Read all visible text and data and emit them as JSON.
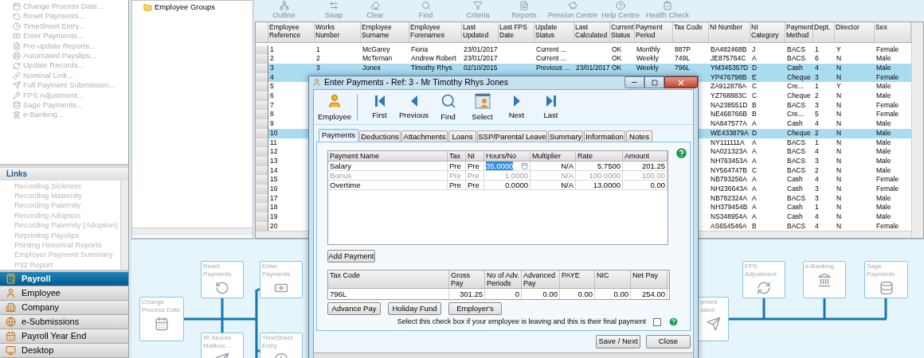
{
  "tasks": [
    {
      "label": "Change Process Date...",
      "disabled": true
    },
    {
      "label": "Reset Payments...",
      "disabled": true
    },
    {
      "label": "TimeSheet Entry...",
      "disabled": true
    },
    {
      "label": "Enter Payments...",
      "disabled": true
    },
    {
      "label": "Pre-update Reports...",
      "disabled": true
    },
    {
      "label": "Automated Payslips...",
      "disabled": true
    },
    {
      "label": "Update Records...",
      "disabled": true
    },
    {
      "label": "Nominal Link...",
      "disabled": true
    },
    {
      "label": "Full Payment Submission...",
      "disabled": true
    },
    {
      "label": "FPS Adjustment...",
      "disabled": true
    },
    {
      "label": "Sage Payments...",
      "disabled": true
    },
    {
      "label": "e-Banking...",
      "disabled": true
    }
  ],
  "links": {
    "title": "Links",
    "items": [
      {
        "label": "Recording Sickness",
        "disabled": true
      },
      {
        "label": "Recording Maternity",
        "disabled": true
      },
      {
        "label": "Recording Paternity",
        "disabled": true
      },
      {
        "label": "Recording Adoption",
        "disabled": true
      },
      {
        "label": "Recording Paternity (Adoption)",
        "disabled": true
      },
      {
        "label": "Reprinting Payslips",
        "disabled": true
      },
      {
        "label": "Printing Historical Reports",
        "disabled": true
      },
      {
        "label": "Employer Payment Summary",
        "disabled": true
      },
      {
        "label": "P32 Report",
        "disabled": true
      }
    ]
  },
  "nav": [
    {
      "label": "Payroll",
      "selected": true
    },
    {
      "label": "Employee",
      "selected": false
    },
    {
      "label": "Company",
      "selected": false
    },
    {
      "label": "e-Submissions",
      "selected": false
    },
    {
      "label": "Payroll Year End",
      "selected": false
    },
    {
      "label": "Desktop",
      "selected": false
    }
  ],
  "tree": {
    "items": [
      {
        "label": "Employee Groups"
      }
    ]
  },
  "toolbar": [
    {
      "label": "Outline",
      "disabled": true
    },
    {
      "label": "Swap",
      "disabled": true
    },
    {
      "label": "Clear",
      "disabled": true
    },
    {
      "label": "Find",
      "disabled": true
    },
    {
      "label": "Criteria",
      "disabled": true
    },
    {
      "label": "Reports",
      "disabled": true
    },
    {
      "label": "Pension Centre",
      "disabled": true
    },
    {
      "label": "Help Centre",
      "disabled": true
    },
    {
      "label": "Health Check",
      "disabled": true
    }
  ],
  "table": {
    "columns": [
      "Employee Reference",
      "Works Number",
      "Employee Surname",
      "Employee Forenames",
      "Last Updated",
      "Last FPS Date",
      "Update Status",
      "Last Calculated",
      "Current Status",
      "Payment Period",
      "Tax Code",
      "NI Number",
      "NI Category",
      "Payment Method",
      "Dept.",
      "Director",
      "Sex"
    ],
    "rows": [
      {
        "selected": false,
        "cells": [
          "1",
          "1",
          "McGarey",
          "Fiona",
          "23/01/2017",
          null,
          "Current ...",
          null,
          "OK",
          "Monthly",
          "887P",
          "BA482468B",
          "J",
          "BACS",
          "1",
          "Y",
          "Female"
        ]
      },
      {
        "selected": false,
        "cells": [
          "2",
          "2",
          "McTernan",
          "Andrew Robert",
          "23/01/2017",
          null,
          "Current ...",
          null,
          "OK",
          "Weekly",
          "749L",
          "JE875764C",
          "A",
          "BACS",
          "6",
          "N",
          "Male"
        ]
      },
      {
        "selected": true,
        "cells": [
          "3",
          "3",
          "Jones",
          "Timothy Rhys",
          "02/10/2015",
          null,
          "Previous ...",
          "23/01/2017",
          "OK",
          "Weekly",
          "796L",
          "YM345357D",
          "D",
          "Cash",
          "4",
          "N",
          "Male"
        ]
      },
      {
        "selected": true,
        "cells": [
          "4",
          null,
          null,
          null,
          null,
          null,
          null,
          null,
          null,
          null,
          null,
          "YP476798B",
          "E",
          "Cheque",
          "3",
          "N",
          "Female"
        ]
      },
      {
        "selected": false,
        "cells": [
          "5",
          null,
          null,
          null,
          null,
          null,
          null,
          null,
          null,
          null,
          null,
          "ZA912878A",
          "C",
          "Cre...",
          "1",
          "Y",
          "Male"
        ]
      },
      {
        "selected": false,
        "cells": [
          "6",
          null,
          null,
          null,
          null,
          null,
          null,
          null,
          null,
          null,
          null,
          "YZ768883C",
          "C",
          "Cheque",
          "2",
          "N",
          "Male"
        ]
      },
      {
        "selected": false,
        "cells": [
          "7",
          null,
          null,
          null,
          null,
          null,
          null,
          null,
          null,
          null,
          null,
          "NA238551D",
          "B",
          "BACS",
          "3",
          "N",
          "Female"
        ]
      },
      {
        "selected": false,
        "cells": [
          "8",
          null,
          null,
          null,
          null,
          null,
          null,
          null,
          null,
          null,
          null,
          "NE468766B",
          "B",
          "Cre...",
          "5",
          "N",
          "Female"
        ]
      },
      {
        "selected": false,
        "cells": [
          "9",
          null,
          null,
          null,
          null,
          null,
          null,
          null,
          null,
          null,
          null,
          "NA847577A",
          "A",
          "Cash",
          "4",
          "N",
          "Male"
        ]
      },
      {
        "selected": true,
        "cells": [
          "10",
          null,
          null,
          null,
          null,
          null,
          null,
          null,
          null,
          null,
          null,
          "WE433879A",
          "D",
          "Cheque",
          "2",
          "N",
          "Male"
        ]
      },
      {
        "selected": false,
        "cells": [
          "11",
          null,
          null,
          null,
          null,
          null,
          null,
          null,
          null,
          null,
          null,
          "NY111111A",
          "A",
          "BACS",
          "1",
          "N",
          "Male"
        ]
      },
      {
        "selected": false,
        "cells": [
          "12",
          null,
          null,
          null,
          null,
          null,
          null,
          null,
          null,
          null,
          null,
          "NA021323A",
          "A",
          "BACS",
          "4",
          "N",
          "Male"
        ]
      },
      {
        "selected": false,
        "cells": [
          "13",
          null,
          null,
          null,
          null,
          null,
          null,
          null,
          null,
          null,
          null,
          "NH763453A",
          "A",
          "BACS",
          "3",
          "N",
          "Male"
        ]
      },
      {
        "selected": false,
        "cells": [
          "14",
          null,
          null,
          null,
          null,
          null,
          null,
          null,
          null,
          null,
          null,
          "NY564747B",
          "C",
          "BACS",
          "2",
          "N",
          "Male"
        ]
      },
      {
        "selected": false,
        "cells": [
          "15",
          null,
          null,
          null,
          null,
          null,
          null,
          null,
          null,
          null,
          null,
          "NB793256A",
          "A",
          "Cash",
          "4",
          "N",
          "Female"
        ]
      },
      {
        "selected": false,
        "cells": [
          "16",
          null,
          null,
          null,
          null,
          null,
          null,
          null,
          null,
          null,
          null,
          "NH236643A",
          "A",
          "Cash",
          "3",
          "N",
          "Female"
        ]
      },
      {
        "selected": false,
        "cells": [
          "17",
          null,
          null,
          null,
          null,
          null,
          null,
          null,
          null,
          null,
          null,
          "NB782324A",
          "A",
          "BACS",
          "3",
          "N",
          "Male"
        ]
      },
      {
        "selected": false,
        "cells": [
          "18",
          null,
          null,
          null,
          null,
          null,
          null,
          null,
          null,
          null,
          null,
          "NH379454B",
          "A",
          "Cash",
          "1",
          "N",
          "Male"
        ]
      },
      {
        "selected": false,
        "cells": [
          "19",
          null,
          null,
          null,
          null,
          null,
          null,
          null,
          null,
          null,
          null,
          "NS348954A",
          "A",
          "Cash",
          "4",
          "N",
          "Male"
        ]
      },
      {
        "selected": false,
        "cells": [
          "20",
          null,
          null,
          null,
          null,
          null,
          null,
          null,
          null,
          null,
          null,
          "AS654546A",
          "B",
          "BACS",
          "4",
          "N",
          "Female"
        ]
      }
    ]
  },
  "flow": {
    "nodes": [
      {
        "lines": [
          "Change",
          "Process Date"
        ]
      },
      {
        "lines": [
          "Reset",
          "Payments"
        ]
      },
      {
        "lines": [
          "IR Secure",
          "Mailbox..."
        ]
      },
      {
        "lines": [
          "Enter",
          "Payments"
        ]
      },
      {
        "lines": [
          "TimeSheet",
          "Entry"
        ]
      },
      {
        "lines": [
          "yment",
          "ssion"
        ]
      },
      {
        "lines": [
          "FPS",
          "Adjustment"
        ]
      },
      {
        "lines": [
          "e-Banking"
        ]
      },
      {
        "lines": [
          "Sage",
          "Payments"
        ]
      }
    ]
  },
  "dialog": {
    "title": "Enter Payments - Ref: 3 - Mr Timothy Rhys Jones",
    "nav": [
      {
        "label": "Employee"
      },
      {
        "label": "First"
      },
      {
        "label": "Previous"
      },
      {
        "label": "Find"
      },
      {
        "label": "Select"
      },
      {
        "label": "Next"
      },
      {
        "label": "Last"
      }
    ],
    "tabs": [
      {
        "label": "Payments",
        "selected": true
      },
      {
        "label": "Deductions",
        "selected": false
      },
      {
        "label": "Attachments",
        "selected": false
      },
      {
        "label": "Loans",
        "selected": false
      },
      {
        "label": "SSP/Parental Leave",
        "selected": false
      },
      {
        "label": "Summary",
        "selected": false
      },
      {
        "label": "Information",
        "selected": false
      },
      {
        "label": "Notes",
        "selected": false
      }
    ],
    "payments": {
      "columns": [
        "Payment Name",
        "Tax",
        "NI",
        "Hours/No",
        "Multiplier",
        "Rate",
        "Amount"
      ],
      "rows": [
        {
          "disabled": false,
          "editing": true,
          "cells": [
            "Salary",
            "Pre",
            "Pre",
            "35.0000",
            "N/A",
            "5.7500",
            "201.25"
          ]
        },
        {
          "disabled": true,
          "editing": false,
          "cells": [
            "Bonus",
            "Pre",
            "Pre",
            "1.0000",
            "N/A",
            "100.0000",
            "100.00"
          ]
        },
        {
          "disabled": false,
          "editing": false,
          "cells": [
            "Overtime",
            "Pre",
            "Pre",
            "0.0000",
            "N/A",
            "13.0000",
            "0.00"
          ]
        }
      ]
    },
    "add_button": "Add Payment",
    "totals": {
      "columns": [
        "Tax Code",
        "Gross Pay",
        "No of Adv. Periods",
        "Advanced Pay",
        "PAYE",
        "NIC",
        "Net Pay"
      ],
      "cells": [
        "796L",
        "301.25",
        "0",
        "0.00",
        "0.00",
        "0.00",
        "254.00"
      ]
    },
    "buttons": [
      "Advance Pay",
      "Holiday Fund",
      "Employer's"
    ],
    "final_payment": {
      "label": "Select this check box if your employee is leaving and this is their final payment",
      "checked": false
    },
    "footer_buttons": [
      "Save / Next",
      "Close"
    ]
  }
}
